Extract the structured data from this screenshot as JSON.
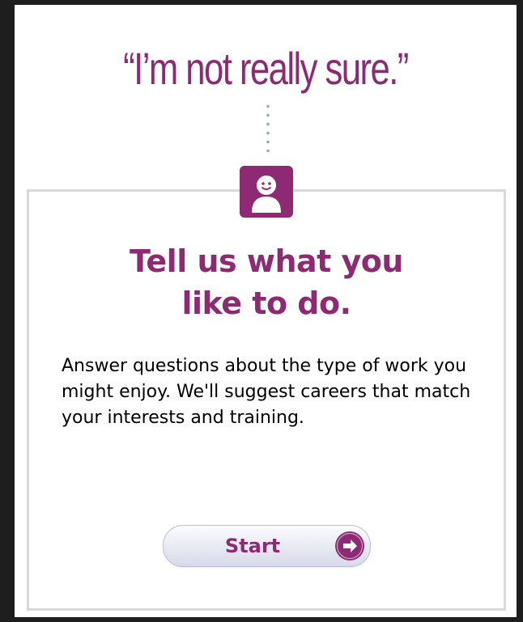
{
  "quote": "“I’m not really sure.”",
  "card": {
    "headline_line1": "Tell us what you",
    "headline_line2": "like to do.",
    "description": "Answer questions about the type of work you might enjoy. We'll suggest careers that match your interests and training.",
    "start_label": "Start"
  },
  "icons": {
    "avatar": "person-face-icon",
    "start_arrow": "arrow-right-circle-icon"
  },
  "colors": {
    "brand_purple": "#8e2a73",
    "dots": "#8fb0a8",
    "card_border": "#d9d9d9",
    "button_border": "#b9bfd6",
    "page_background": "#1e1e1e"
  }
}
